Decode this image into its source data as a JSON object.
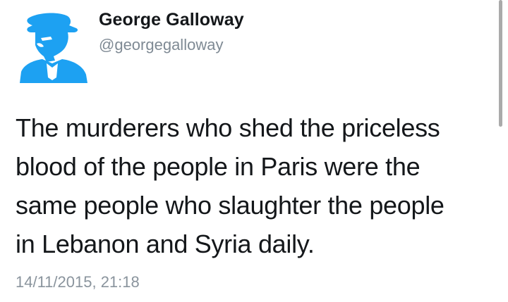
{
  "tweet": {
    "author_name": "George Galloway",
    "author_handle": "@georgegalloway",
    "avatar_icon": "profile-silhouette-icon",
    "avatar_color": "#1da1f2",
    "text_lines": [
      "The murderers who shed the priceless",
      "blood of the people in Paris were the",
      "same people who slaughter the people",
      "in Lebanon and Syria daily."
    ],
    "timestamp": "14/11/2015, 21:18"
  }
}
